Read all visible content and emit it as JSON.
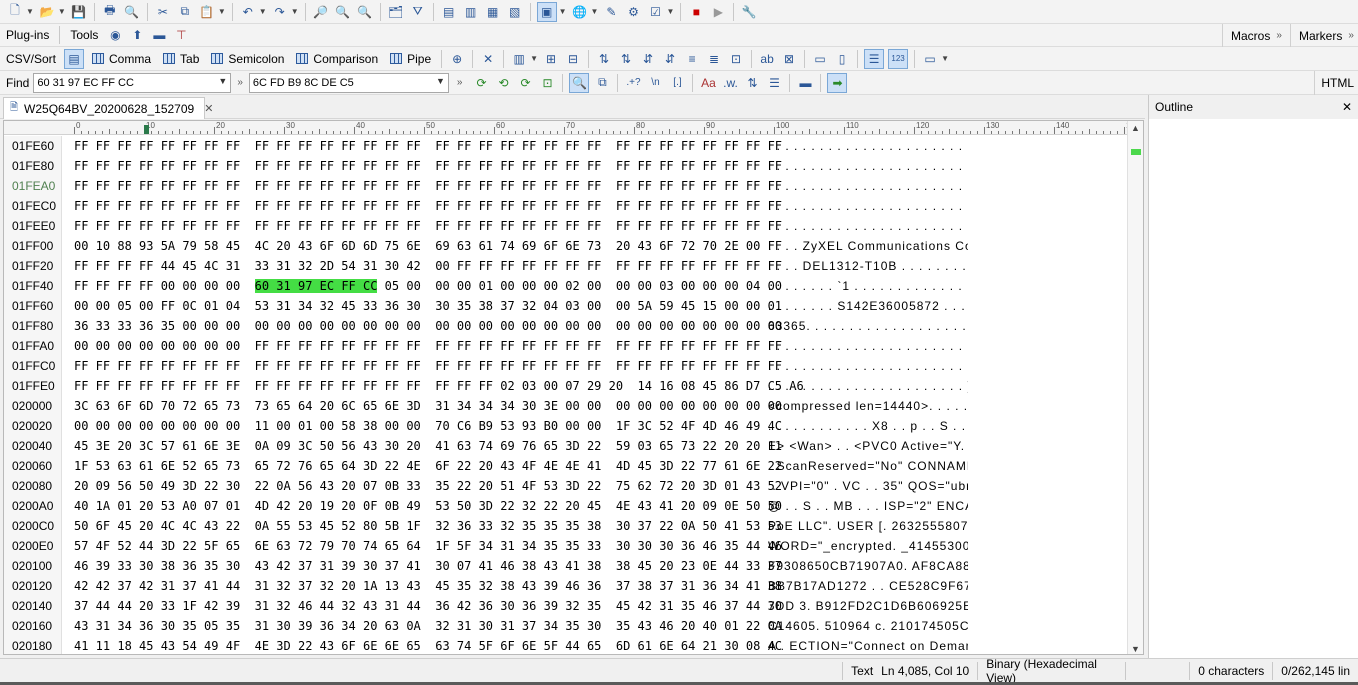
{
  "toolbar_menus": {
    "plugins": "Plug-ins",
    "tools": "Tools",
    "macros": "Macros",
    "markers": "Markers"
  },
  "csv": {
    "label": "CSV/Sort",
    "buttons": [
      "Comma",
      "Tab",
      "Semicolon",
      "Comparison",
      "Pipe"
    ]
  },
  "find": {
    "label": "Find",
    "find_value": "60 31 97 EC FF CC",
    "replace_value": "6C FD B9 8C DE C5",
    "html_label": "HTML"
  },
  "tab": {
    "title": "W25Q64BV_20200628_152709",
    "close": "✕"
  },
  "outline": {
    "title": "Outline",
    "close": "✕"
  },
  "ruler_labels": [
    "0",
    "10",
    "20",
    "30",
    "40",
    "50",
    "60",
    "70",
    "80",
    "90",
    "100",
    "110",
    "120",
    "130",
    "140",
    "150"
  ],
  "hex_rows": [
    {
      "off": "01FE60",
      "hex": "FF FF FF FF FF FF FF FF  FF FF FF FF FF FF FF FF  FF FF FF FF FF FF FF FF  FF FF FF FF FF FF FF FF",
      "asc": ". . . . . . . . . . . . . . . . . . . . . . . . . . . . . . . ."
    },
    {
      "off": "01FE80",
      "hex": "FF FF FF FF FF FF FF FF  FF FF FF FF FF FF FF FF  FF FF FF FF FF FF FF FF  FF FF FF FF FF FF FF FF",
      "asc": ". . . . . . . . . . . . . . . . . . . . . . . . . . . . . . . ."
    },
    {
      "off": "01FEA0",
      "hex": "FF FF FF FF FF FF FF FF  FF FF FF FF FF FF FF FF  FF FF FF FF FF FF FF FF  FF FF FF FF FF FF FF FF",
      "asc": ". . . . . . . . . . . . . . . . . . . . . . . . . . . . . . . .",
      "cur": true
    },
    {
      "off": "01FEC0",
      "hex": "FF FF FF FF FF FF FF FF  FF FF FF FF FF FF FF FF  FF FF FF FF FF FF FF FF  FF FF FF FF FF FF FF FF",
      "asc": ". . . . . . . . . . . . . . . . . . . . . . . . . . . . . . . ."
    },
    {
      "off": "01FEE0",
      "hex": "FF FF FF FF FF FF FF FF  FF FF FF FF FF FF FF FF  FF FF FF FF FF FF FF FF  FF FF FF FF FF FF FF FF",
      "asc": ". . . . . . . . . . . . . . . . . . . . . . . . . . . . . . . ."
    },
    {
      "off": "01FF00",
      "hex": "00 10 88 93 5A 79 58 45  4C 20 43 6F 6D 6D 75 6E  69 63 61 74 69 6F 6E 73  20 43 6F 72 70 2E 00 FF",
      "asc": ". . . . ZyXEL Communications Corp."
    },
    {
      "off": "01FF20",
      "hex": "FF FF FF FF 44 45 4C 31  33 31 32 2D 54 31 30 42  00 FF FF FF FF FF FF FF  FF FF FF FF FF FF FF FF",
      "asc": ". . . . DEL1312-T10B . . . . . . . . . . . . . . ."
    },
    {
      "off": "01FF40",
      "hex_pre": "FF FF FF FF 00 00 00 00  ",
      "hex_hl": "60 31 97 EC FF CC",
      "hex_post": " 05 00  00 00 01 00 00 00 02 00  00 00 03 00 00 00 04 00",
      "asc": ". . . . . . . . `1 . . . . . . . . . . . . . . . ."
    },
    {
      "off": "01FF60",
      "hex": "00 00 05 00 FF 0C 01 04  53 31 34 32 45 33 36 30  30 35 38 37 32 04 03 00  00 5A 59 45 15 00 00 01",
      "asc": ". . . . . . . . S142E36005872 . . . ZYE ."
    },
    {
      "off": "01FF80",
      "hex": "36 33 33 36 35 00 00 00  00 00 00 00 00 00 00 00  00 00 00 00 00 00 00 00  00 00 00 00 00 00 00 00",
      "asc": "63365. . . . . . . . . . . . . . . . . . . . . . . ."
    },
    {
      "off": "01FFA0",
      "hex": "00 00 00 00 00 00 00 00  FF FF FF FF FF FF FF FF  FF FF FF FF FF FF FF FF  FF FF FF FF FF FF FF FF",
      "asc": ". . . . . . . . . . . . . . . . . . . . . . . . . . . . . . . ."
    },
    {
      "off": "01FFC0",
      "hex": "FF FF FF FF FF FF FF FF  FF FF FF FF FF FF FF FF  FF FF FF FF FF FF FF FF  FF FF FF FF FF FF FF FF",
      "asc": ". . . . . . . . . . . . . . . . . . . . . . . . . . . . . . . ."
    },
    {
      "off": "01FFE0",
      "hex": "FF FF FF FF FF FF FF FF  FF FF FF FF FF FF FF FF  FF FF FF 02 03 00 07 29 20  14 16 08 45 86 D7 C5 A6",
      "asc": ". . . . . . . . . . . . . . . . . . . . . . . ) . . . E . . ."
    },
    {
      "off": "020000",
      "hex": "3C 63 6F 6D 70 72 65 73  73 65 64 20 6C 65 6E 3D  31 34 34 34 30 3E 00 00  00 00 00 00 00 00 00 00",
      "asc": "<compressed len=14440>. . . . . . . . . ."
    },
    {
      "off": "020020",
      "hex": "00 00 00 00 00 00 00 00  11 00 01 00 58 38 00 00  70 C6 B9 53 93 B0 00 00  1F 3C 52 4F 4D 46 49 4C",
      "asc": ". . . . . . . . . . . . X8 . . p . . S . . . . <ROM"
    },
    {
      "off": "020040",
      "hex": "45 3E 20 3C 57 61 6E 3E  0A 09 3C 50 56 43 30 20  41 63 74 69 76 65 3D 22  59 03 65 73 22 20 20 11",
      "asc": "E> <Wan> . . <PVC0 Active=\"Y. es\""
    },
    {
      "off": "020060",
      "hex": "1F 53 63 61 6E 52 65 73  65 72 76 65 64 3D 22 4E  6F 22 20 43 4F 4E 4E 41  4D 45 3D 22 77 61 6E 22",
      "asc": ". ScanReserved=\"No\" CONNAME=\"wa"
    },
    {
      "off": "020080",
      "hex": "20 09 56 50 49 3D 22 30  22 0A 56 43 20 07 0B 33  35 22 20 51 4F 53 3D 22  75 62 72 20 3D 01 43 52",
      "asc": " . VPI=\"0\" . VC . . 35\" QOS=\"ubr ="
    },
    {
      "off": "0200A0",
      "hex": "40 1A 01 20 53 A0 07 01  4D 42 20 19 20 0F 0B 49  53 50 3D 22 32 22 20 45  4E 43 41 20 09 0E 50 50",
      "asc": "@ . . S . . MB . . . ISP=\"2\" ENCA . ."
    },
    {
      "off": "0200C0",
      "hex": "50 6F 45 20 4C 4C 43 22  0A 55 53 45 52 80 5B 1F  32 36 33 32 35 35 35 38  30 37 22 0A 50 41 53 53",
      "asc": "PoE LLC\". USER [. 2632555807\". PA"
    },
    {
      "off": "0200E0",
      "hex": "57 4F 52 44 3D 22 5F 65  6E 63 72 79 70 74 65 64  1F 5F 34 31 34 35 35 33  30 30 30 36 46 35 44 46",
      "asc": "WORD=\"_encrypted. _4145530006F5"
    },
    {
      "off": "020100",
      "hex": "46 39 33 30 38 36 35 30  43 42 37 31 39 30 37 41  30 07 41 46 38 43 41 38  38 45 20 23 0E 44 33 37",
      "asc": "F9308650CB71907A0. AF8CA88E #. D"
    },
    {
      "off": "020120",
      "hex": "42 42 37 42 31 37 41 44  31 32 37 32 20 1A 13 43  45 35 32 38 43 39 46 36  37 38 37 31 36 34 41 38",
      "asc": "BB7B17AD1272 . . CE528C9F678716"
    },
    {
      "off": "020140",
      "hex": "37 44 44 20 33 1F 42 39  31 32 46 44 32 43 31 44  36 42 36 30 36 39 32 35  45 42 31 35 46 37 44 30",
      "asc": "7DD 3. B912FD2C1D6B606925EB15F7"
    },
    {
      "off": "020160",
      "hex": "43 31 34 36 30 35 05 35  31 30 39 36 34 20 63 0A  32 31 30 31 37 34 35 30  35 43 46 20 40 01 22 0A",
      "asc": "C14605. 510964 c. 210174505CF @"
    },
    {
      "off": "020180",
      "hex": "41 11 18 45 43 54 49 4F  4E 3D 22 43 6F 6E 6E 65  63 74 5F 6F 6E 5F 44 65  6D 61 6E 64 21 30 08 4C",
      "asc": "A . ECTION=\"Connect on Demand!0"
    }
  ],
  "status": {
    "text": "Text",
    "pos": "Ln 4,085, Col 10",
    "mode": "Binary (Hexadecimal View)",
    "chars": "0 characters",
    "lines": "0/262,145 lin"
  },
  "colors": {
    "highlight": "#44dd44",
    "current_offset": "#508050"
  }
}
